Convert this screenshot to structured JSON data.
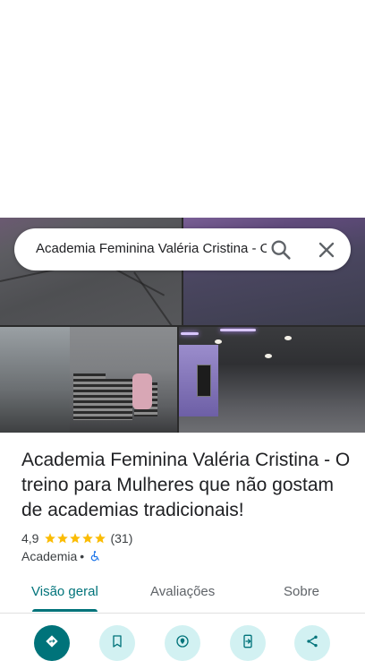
{
  "search": {
    "query": "Academia Feminina Valéria Cristina - O treino para Mulheres que não gostam de academias tradicionais!"
  },
  "place": {
    "title": "Academia Feminina Valéria Cristina - O treino para Mulheres que não gostam de academias tradicionais!",
    "rating": "4,9",
    "rating_value": 4.9,
    "review_count": "(31)",
    "category": "Academia",
    "separator": "•"
  },
  "tabs": [
    {
      "label": "Visão geral",
      "active": true
    },
    {
      "label": "Avaliações",
      "active": false
    },
    {
      "label": "Sobre",
      "active": false
    }
  ],
  "actions": [
    {
      "icon": "directions-icon"
    },
    {
      "icon": "bookmark-icon"
    },
    {
      "icon": "nearby-icon"
    },
    {
      "icon": "send-to-phone-icon"
    },
    {
      "icon": "share-icon"
    }
  ],
  "colors": {
    "accent": "#00737a",
    "action_background": "#d2f1f2",
    "star": "#fbbc04",
    "accessibility": "#1a73e8"
  }
}
